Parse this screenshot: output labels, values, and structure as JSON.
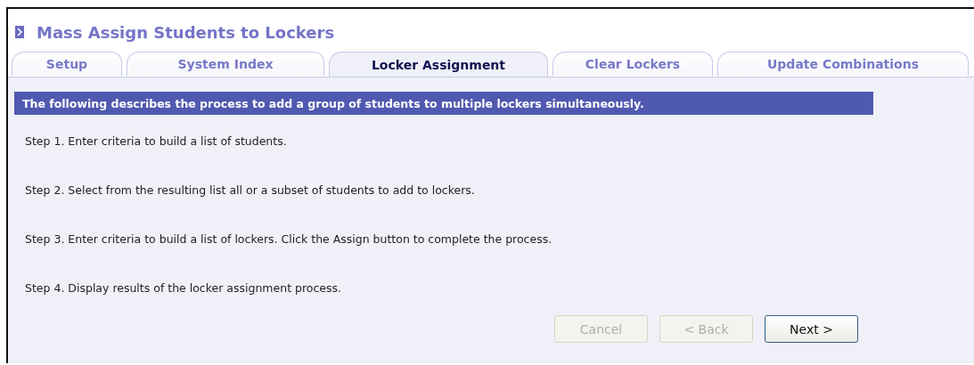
{
  "title": "Mass Assign Students to Lockers",
  "tabs": [
    {
      "label": "Setup",
      "selected": false
    },
    {
      "label": "System Index",
      "selected": false
    },
    {
      "label": "Locker Assignment",
      "selected": true
    },
    {
      "label": "Clear Lockers",
      "selected": false
    },
    {
      "label": "Update Combinations",
      "selected": false
    }
  ],
  "banner": "The following describes the process to add a group of students to multiple lockers simultaneously.",
  "steps": [
    "Step 1. Enter criteria to build a list of students.",
    "Step 2. Select from the resulting list all or a subset of students to add to lockers.",
    "Step 3. Enter criteria to build a list of lockers. Click the Assign button to complete the process.",
    "Step 4. Display results of the locker assignment process."
  ],
  "buttons": [
    {
      "label": "Cancel",
      "disabled": true
    },
    {
      "label": "< Back",
      "disabled": true
    },
    {
      "label": "Next >",
      "disabled": false
    }
  ]
}
